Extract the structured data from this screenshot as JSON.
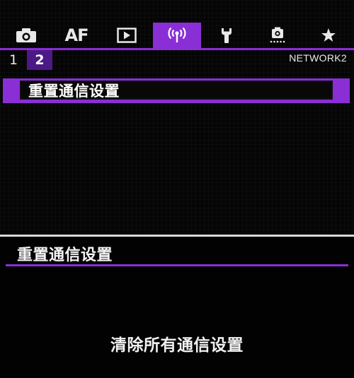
{
  "tabs": [
    {
      "id": "shooting",
      "icon": "camera-icon",
      "label": ""
    },
    {
      "id": "af",
      "icon": "",
      "label": "AF"
    },
    {
      "id": "playback",
      "icon": "playback-icon",
      "label": ""
    },
    {
      "id": "network",
      "icon": "wireless-icon",
      "label": "",
      "active": true
    },
    {
      "id": "setup",
      "icon": "wrench-icon",
      "label": ""
    },
    {
      "id": "custom",
      "icon": "custom-functions-icon",
      "label": ""
    },
    {
      "id": "mymenu",
      "icon": "star-icon",
      "label": ""
    }
  ],
  "subtabs": [
    {
      "label": "1",
      "active": false
    },
    {
      "label": "2",
      "active": true
    }
  ],
  "page_code": "NETWORK2",
  "menu": {
    "items": [
      {
        "label": "重置通信设置",
        "selected": true
      }
    ]
  },
  "detail": {
    "title": "重置通信设置",
    "description": "清除所有通信设置"
  },
  "colors": {
    "accent": "#8a2fd6",
    "subtab_active": "#4b1a86",
    "background": "#050505",
    "text": "#f2f2f2"
  }
}
